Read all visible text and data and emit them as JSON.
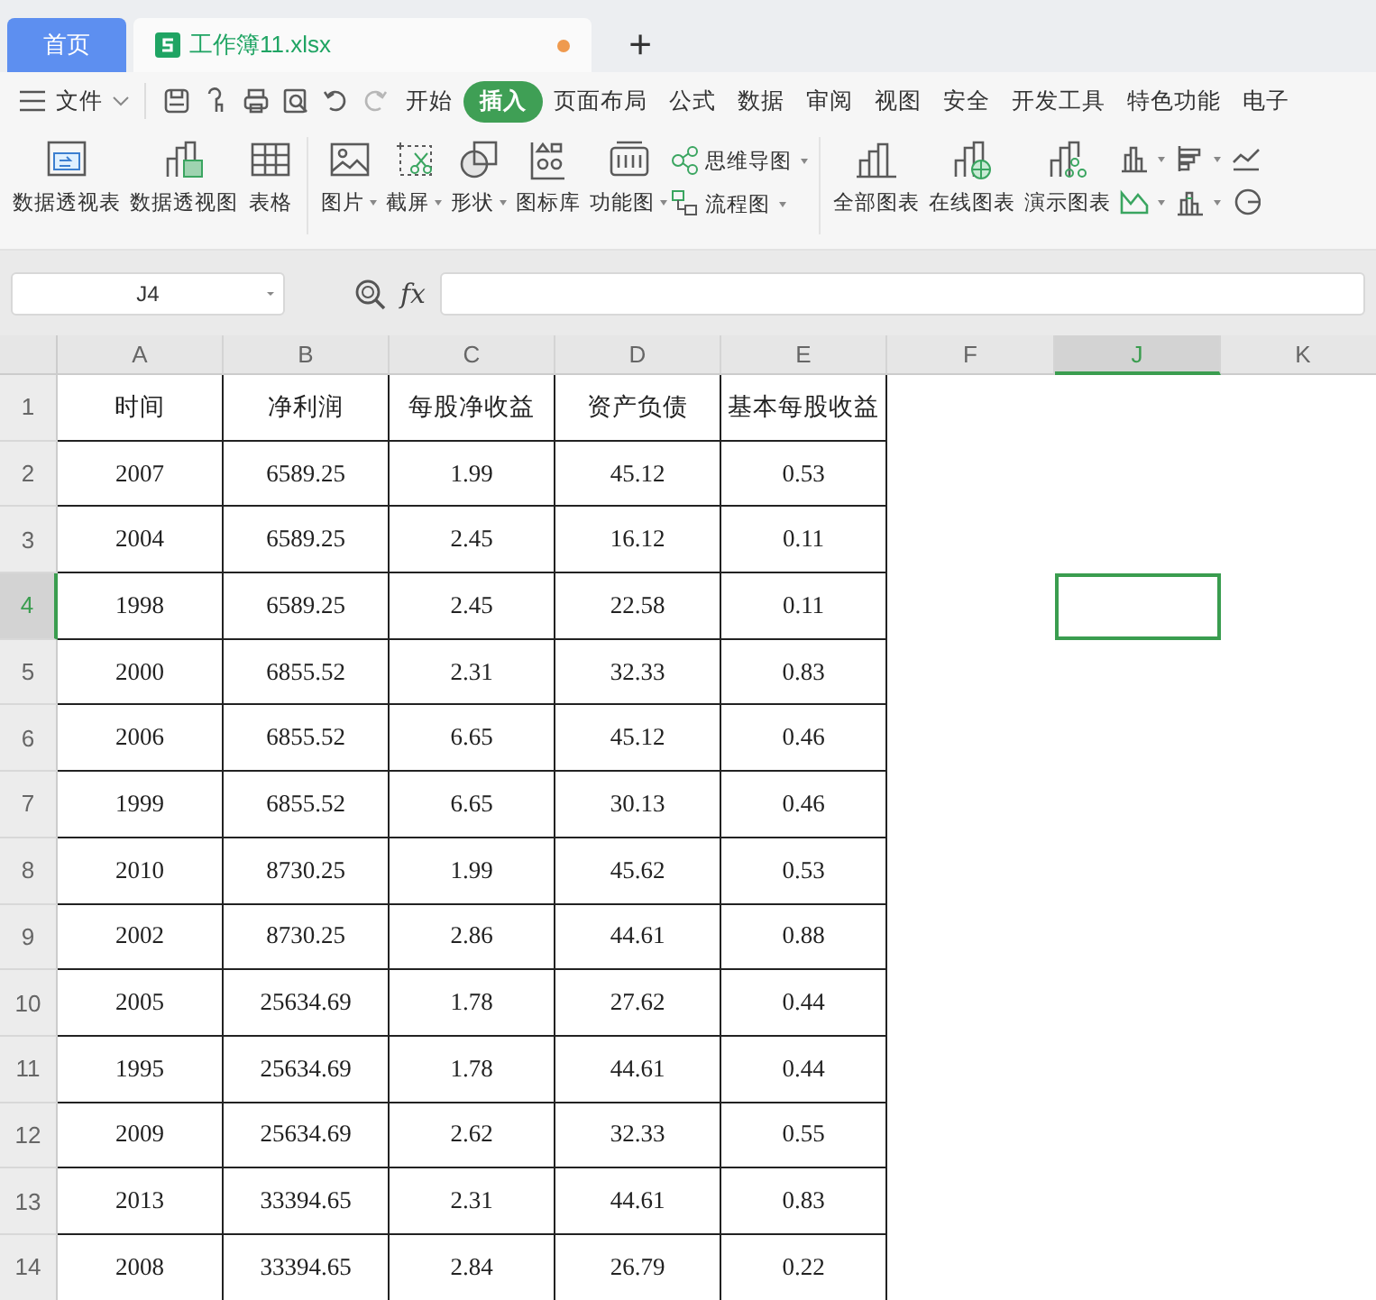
{
  "tabs": [
    {
      "label": "首页",
      "kind": "home",
      "selected": false
    },
    {
      "label": "工作簿11.xlsx",
      "kind": "file",
      "selected": true,
      "unsaved": true
    }
  ],
  "new_tab": "+",
  "menu": {
    "file": "文件",
    "quick_access": [
      {
        "kind": "save",
        "disabled": false
      },
      {
        "kind": "format-painter",
        "disabled": false
      },
      {
        "kind": "print",
        "disabled": false
      },
      {
        "kind": "preview",
        "disabled": false
      },
      {
        "kind": "undo",
        "disabled": false
      },
      {
        "kind": "redo",
        "disabled": true
      }
    ],
    "tabs": [
      {
        "label": "开始",
        "selected": false
      },
      {
        "label": "插入",
        "selected": true
      },
      {
        "label": "页面布局",
        "selected": false
      },
      {
        "label": "公式",
        "selected": false
      },
      {
        "label": "数据",
        "selected": false
      },
      {
        "label": "审阅",
        "selected": false
      },
      {
        "label": "视图",
        "selected": false
      },
      {
        "label": "安全",
        "selected": false
      },
      {
        "label": "开发工具",
        "selected": false
      },
      {
        "label": "特色功能",
        "selected": false
      },
      {
        "label": "电子",
        "selected": false
      }
    ]
  },
  "ribbon": [
    {
      "kind": "large",
      "items": [
        {
          "label": "数据透视表",
          "kind": "pivot-table",
          "dropdown": false
        },
        {
          "label": "数据透视图",
          "kind": "pivot-chart",
          "dropdown": false
        },
        {
          "label": "表格",
          "kind": "table",
          "dropdown": false
        }
      ]
    },
    {
      "kind": "large",
      "items": [
        {
          "label": "图片",
          "kind": "picture",
          "dropdown": true
        },
        {
          "label": "截屏",
          "kind": "screenshot",
          "dropdown": true
        },
        {
          "label": "形状",
          "kind": "shapes",
          "dropdown": true
        },
        {
          "label": "图标库",
          "kind": "icon-library",
          "dropdown": false
        },
        {
          "label": "功能图",
          "kind": "function-chart",
          "dropdown": true
        }
      ]
    },
    {
      "kind": "small",
      "items": [
        {
          "label": "思维导图",
          "kind": "mind-map",
          "dropdown": true
        },
        {
          "label": "流程图",
          "kind": "flowchart",
          "dropdown": true
        }
      ]
    },
    {
      "kind": "large",
      "items": [
        {
          "label": "全部图表",
          "kind": "all-charts",
          "dropdown": false
        },
        {
          "label": "在线图表",
          "kind": "online-chart",
          "dropdown": false
        },
        {
          "label": "演示图表",
          "kind": "demo-chart",
          "dropdown": false
        }
      ]
    },
    {
      "kind": "icons",
      "items": [
        {
          "kind": "column-chart",
          "dropdown": true
        },
        {
          "kind": "bar-chart",
          "dropdown": true
        },
        {
          "kind": "line-chart",
          "dropdown": false
        },
        {
          "kind": "area-chart",
          "dropdown": true
        },
        {
          "kind": "stacked-chart",
          "dropdown": true
        },
        {
          "kind": "pie-chart",
          "dropdown": false
        }
      ]
    }
  ],
  "name_box": "J4",
  "formula": {
    "fx": "fx"
  },
  "columns": [
    {
      "label": "A",
      "selected": false
    },
    {
      "label": "B",
      "selected": false
    },
    {
      "label": "C",
      "selected": false
    },
    {
      "label": "D",
      "selected": false
    },
    {
      "label": "E",
      "selected": false
    },
    {
      "label": "F",
      "selected": false
    },
    {
      "label": "J",
      "selected": true
    },
    {
      "label": "K",
      "selected": false
    }
  ],
  "rows": [
    {
      "header": "1",
      "selected": false,
      "cells": [
        "时间",
        "净利润",
        "每股净收益",
        "资产负债",
        "基本每股收益"
      ]
    },
    {
      "header": "2",
      "selected": false,
      "cells": [
        "2007",
        "6589.25",
        "1.99",
        "45.12",
        "0.53"
      ]
    },
    {
      "header": "3",
      "selected": false,
      "cells": [
        "2004",
        "6589.25",
        "2.45",
        "16.12",
        "0.11"
      ]
    },
    {
      "header": "4",
      "selected": true,
      "cells": [
        "1998",
        "6589.25",
        "2.45",
        "22.58",
        "0.11"
      ]
    },
    {
      "header": "5",
      "selected": false,
      "cells": [
        "2000",
        "6855.52",
        "2.31",
        "32.33",
        "0.83"
      ]
    },
    {
      "header": "6",
      "selected": false,
      "cells": [
        "2006",
        "6855.52",
        "6.65",
        "45.12",
        "0.46"
      ]
    },
    {
      "header": "7",
      "selected": false,
      "cells": [
        "1999",
        "6855.52",
        "6.65",
        "30.13",
        "0.46"
      ]
    },
    {
      "header": "8",
      "selected": false,
      "cells": [
        "2010",
        "8730.25",
        "1.99",
        "45.62",
        "0.53"
      ]
    },
    {
      "header": "9",
      "selected": false,
      "cells": [
        "2002",
        "8730.25",
        "2.86",
        "44.61",
        "0.88"
      ]
    },
    {
      "header": "10",
      "selected": false,
      "cells": [
        "2005",
        "25634.69",
        "1.78",
        "27.62",
        "0.44"
      ]
    },
    {
      "header": "11",
      "selected": false,
      "cells": [
        "1995",
        "25634.69",
        "1.78",
        "44.61",
        "0.44"
      ]
    },
    {
      "header": "12",
      "selected": false,
      "cells": [
        "2009",
        "25634.69",
        "2.62",
        "32.33",
        "0.55"
      ]
    },
    {
      "header": "13",
      "selected": false,
      "cells": [
        "2013",
        "33394.65",
        "2.31",
        "44.61",
        "0.83"
      ]
    },
    {
      "header": "14",
      "selected": false,
      "cells": [
        "2008",
        "33394.65",
        "2.84",
        "26.79",
        "0.22"
      ]
    }
  ]
}
